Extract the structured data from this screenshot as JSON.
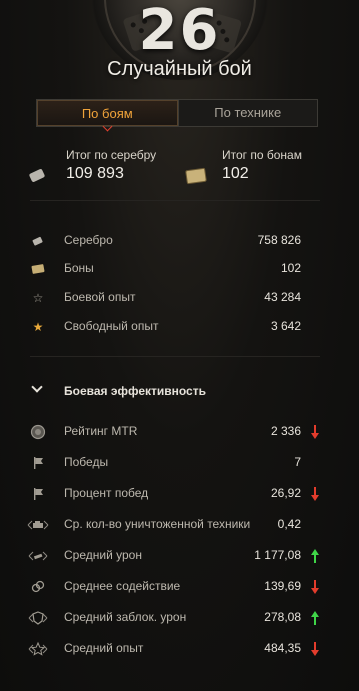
{
  "header": {
    "battles_count": "26",
    "battle_type": "Случайный бой"
  },
  "tabs": [
    {
      "label": "По боям",
      "active": true
    },
    {
      "label": "По технике",
      "active": false
    }
  ],
  "totals": {
    "silver": {
      "label": "Итог по серебру",
      "value": "109 893",
      "icon": "silver-icon"
    },
    "bonds": {
      "label": "Итог по бонам",
      "value": "102",
      "icon": "bonds-icon"
    }
  },
  "earnings": [
    {
      "label": "Серебро",
      "value": "758 826",
      "icon": "silver-icon"
    },
    {
      "label": "Боны",
      "value": "102",
      "icon": "bonds-icon"
    },
    {
      "label": "Боевой опыт",
      "value": "43 284",
      "icon": "star-outline-icon"
    },
    {
      "label": "Свободный опыт",
      "value": "3 642",
      "icon": "star-gold-icon"
    }
  ],
  "section": {
    "title": "Боевая эффективность",
    "expanded": true
  },
  "efficiency": [
    {
      "label": "Рейтинг MTR",
      "value": "2 336",
      "trend": "down",
      "icon": "mtr-badge-icon"
    },
    {
      "label": "Победы",
      "value": "7",
      "trend": "",
      "icon": "flag-icon"
    },
    {
      "label": "Процент побед",
      "value": "26,92",
      "trend": "down",
      "icon": "flag-percent-icon"
    },
    {
      "label": "Ср. кол-во уничтоженной техники",
      "value": "0,42",
      "trend": "",
      "icon": "destroyed-tank-icon"
    },
    {
      "label": "Средний урон",
      "value": "1 177,08",
      "trend": "up",
      "icon": "damage-icon"
    },
    {
      "label": "Среднее содействие",
      "value": "139,69",
      "trend": "down",
      "icon": "assist-icon"
    },
    {
      "label": "Средний заблок. урон",
      "value": "278,08",
      "trend": "up",
      "icon": "blocked-shield-icon"
    },
    {
      "label": "Средний опыт",
      "value": "484,35",
      "trend": "down",
      "icon": "avg-xp-star-icon"
    }
  ],
  "colors": {
    "accent_orange": "#f0a33a",
    "trend_up": "#3fd548",
    "trend_down": "#e33c2c"
  }
}
